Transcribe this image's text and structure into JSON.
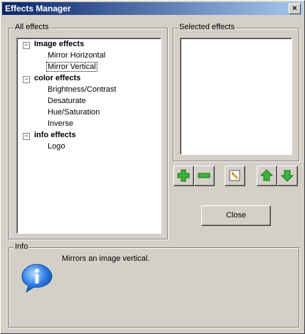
{
  "window": {
    "title": "Effects Manager",
    "close_glyph": "×"
  },
  "all_effects": {
    "legend": "All effects",
    "tree": [
      {
        "label": "Image effects",
        "expander": "−",
        "children": [
          "Mirror Horizontal",
          "Mirror Vertical"
        ]
      },
      {
        "label": "color effects",
        "expander": "−",
        "children": [
          "Brightness/Contrast",
          "Desaturate",
          "Hue/Saturation",
          "Inverse"
        ]
      },
      {
        "label": "info effects",
        "expander": "−",
        "children": [
          "Logo"
        ]
      }
    ],
    "selected_item": "Mirror Vertical"
  },
  "selected_effects": {
    "legend": "Selected effects"
  },
  "toolbar": {
    "icons": [
      "add-icon",
      "remove-icon",
      "edit-icon",
      "move-up-icon",
      "move-down-icon"
    ]
  },
  "close_button": {
    "label": "Close"
  },
  "info": {
    "legend": "Info",
    "message": "Mirrors an image vertical.",
    "icon": "info-icon"
  },
  "colors": {
    "title_start": "#0a246a",
    "title_end": "#a6caf0",
    "face": "#d4d0c8",
    "icon_green": "#2aa12a",
    "info_blue": "#2f7fe8"
  }
}
